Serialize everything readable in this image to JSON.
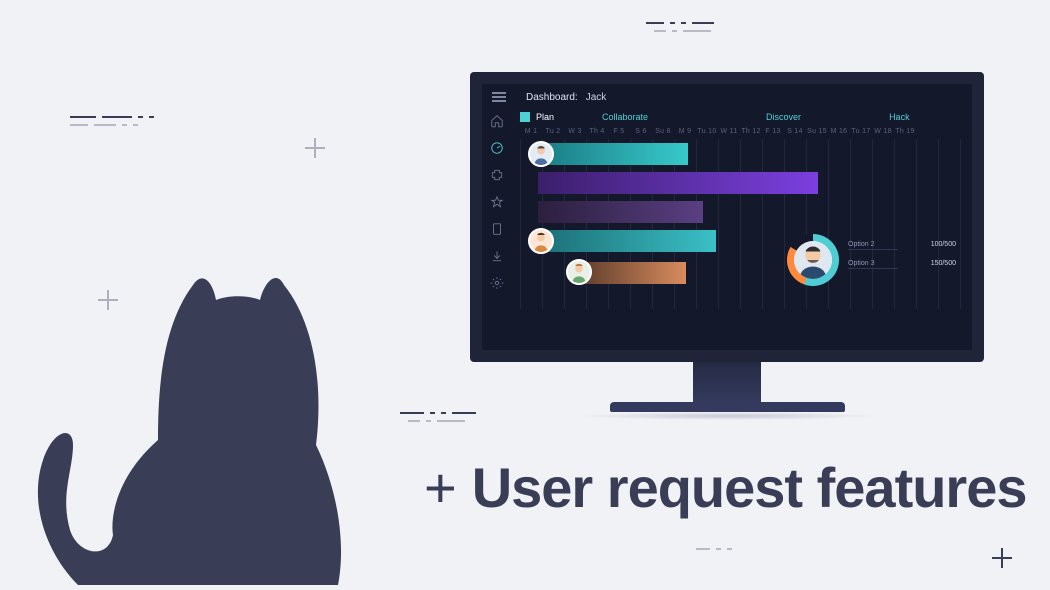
{
  "hero": {
    "plus": "+",
    "text": "User request features"
  },
  "dashboard": {
    "title": "Dashboard:",
    "user": "Jack",
    "tabs": [
      "Plan",
      "Collaborate",
      "Discover",
      "Hack"
    ],
    "dates": [
      "M 1",
      "Tu 2",
      "W 3",
      "Th 4",
      "F 5",
      "S 6",
      "Su 8",
      "M 9",
      "Tu 10",
      "W 11",
      "Th 12",
      "F 13",
      "S 14",
      "Su 15",
      "M 16",
      "Tu 17",
      "W 18",
      "Th 19"
    ],
    "options": [
      {
        "label": "Option 2",
        "value": "100/500"
      },
      {
        "label": "Option 3",
        "value": "150/500"
      }
    ]
  }
}
